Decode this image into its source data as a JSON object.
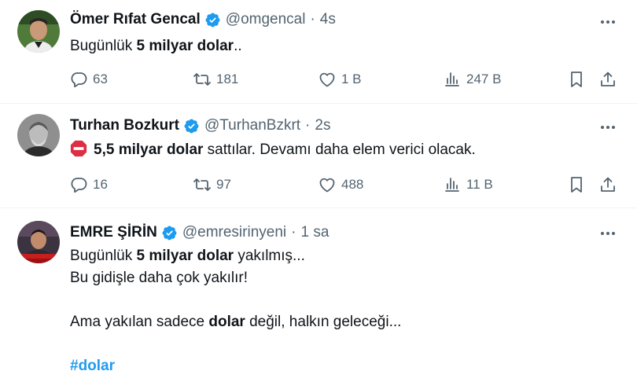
{
  "tweets": [
    {
      "author_name": "Ömer Rıfat Gencal",
      "handle": "@omgencal",
      "separator": "·",
      "time": "4s",
      "text_prefix": "Bugünlük ",
      "text_bold": "5 milyar dolar",
      "text_suffix": "..",
      "replies": "63",
      "retweets": "181",
      "likes": "1 B",
      "views": "247 B"
    },
    {
      "author_name": "Turhan Bozkurt",
      "handle": "@TurhanBzkrt",
      "separator": "·",
      "time": "2s",
      "text_bold": "5,5 milyar dolar",
      "text_suffix": " sattılar. Devamı daha elem verici olacak.",
      "replies": "16",
      "retweets": "97",
      "likes": "488",
      "views": "11 B"
    },
    {
      "author_name": "EMRE ŞİRİN",
      "handle": "@emresirinyeni",
      "separator": "·",
      "time": "1 sa",
      "line1_prefix": "Bugünlük ",
      "line1_bold": "5 milyar dolar",
      "line1_suffix": " yakılmış...",
      "line2": "Bu gidişle daha çok yakılır!",
      "line3_prefix": "Ama yakılan sadece ",
      "line3_bold": "dolar",
      "line3_suffix": " değil, halkın geleceği...",
      "hashtag": "#dolar"
    }
  ],
  "colors": {
    "text": "#0f1419",
    "secondary": "#536471",
    "verified": "#1d9bf0",
    "hashtag": "#1d9bf0",
    "divider": "#eff3f4"
  },
  "icons": {
    "verified": "verified-badge-icon",
    "more": "more-dots-icon",
    "reply": "reply-bubble-icon",
    "retweet": "retweet-arrows-icon",
    "like": "heart-icon",
    "views": "bar-chart-icon",
    "bookmark": "bookmark-icon",
    "share": "share-upload-icon",
    "stop": "stop-sign-emoji"
  }
}
